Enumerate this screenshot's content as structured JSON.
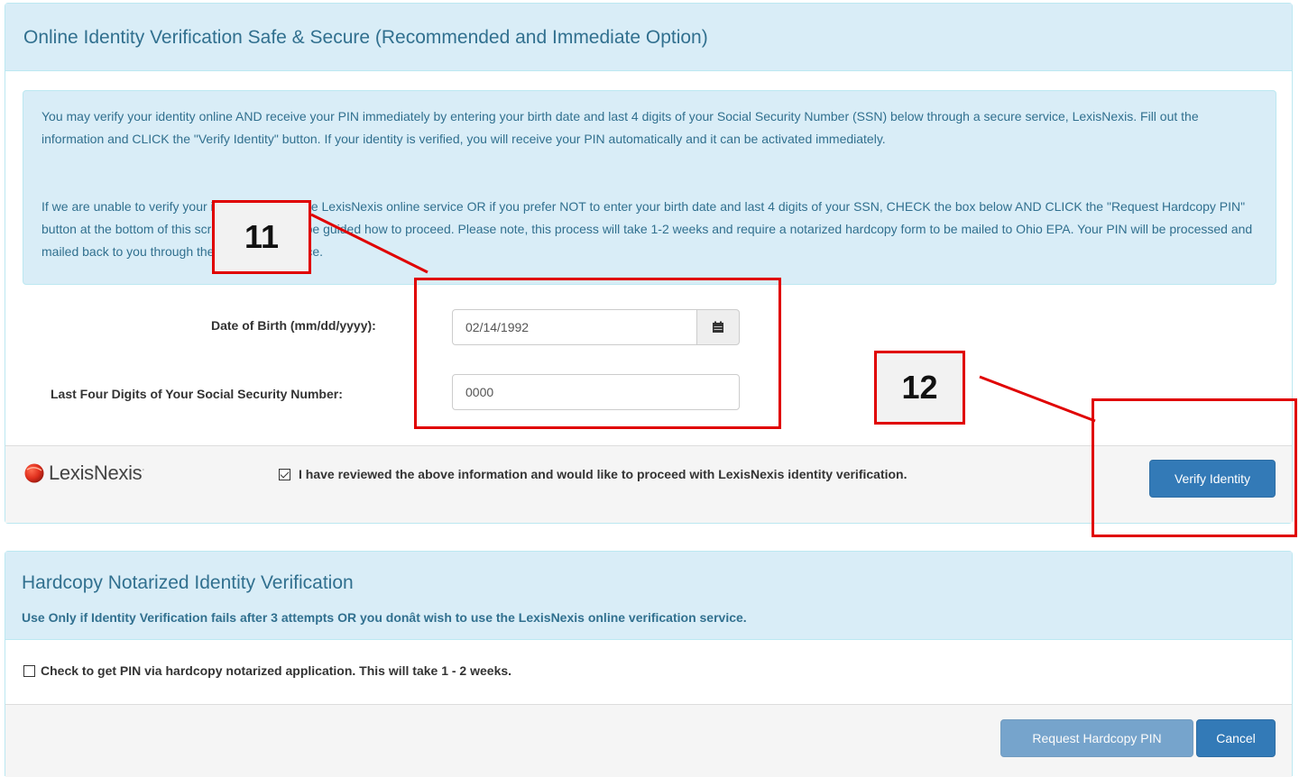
{
  "online_panel": {
    "title": "Online Identity Verification Safe & Secure (Recommended and Immediate Option)",
    "alert_paragraph_1": "You may verify your identity online AND receive your PIN immediately by entering your birth date and last 4 digits of your Social Security Number (SSN) below through a secure service, LexisNexis. Fill out the information and CLICK the \"Verify Identity\" button. If your identity is verified, you will receive your PIN automatically and it can be activated immediately.",
    "alert_paragraph_2": "If we are unable to verify your identity through the LexisNexis online service OR if you prefer NOT to enter your birth date and last 4 digits of your SSN, CHECK the box below AND CLICK the \"Request Hardcopy PIN\" button at the bottom of this screen and you will be guided how to proceed. Please note, this process will take 1-2 weeks and require a notarized hardcopy form to be mailed to Ohio EPA. Your PIN will be processed and mailed back to you through the US Postal Service.",
    "dob_label": "Date of Birth (mm/dd/yyyy):",
    "dob_value": "02/14/1992",
    "ssn_label": "Last Four Digits of Your Social Security Number:",
    "ssn_value": "0000",
    "lexis_logo_text": "LexisNexis",
    "lexis_logo_mark": "·",
    "consent_text": "I have reviewed the above information and would like to proceed with LexisNexis identity verification.",
    "consent_checked": true,
    "verify_button": "Verify Identity"
  },
  "hardcopy_panel": {
    "title": "Hardcopy Notarized Identity Verification",
    "subtitle": "Use Only if Identity Verification fails after 3 attempts OR you donât wish to use the LexisNexis online verification service.",
    "checkbox_text": "Check to get PIN via hardcopy notarized application. This will take 1 - 2 weeks.",
    "checkbox_checked": false,
    "request_button": "Request Hardcopy PIN",
    "cancel_button": "Cancel"
  },
  "annotations": {
    "label_11": "11",
    "label_12": "12",
    "color": "#e00000"
  },
  "colors": {
    "info_bg": "#d9edf7",
    "info_text": "#31708f",
    "primary": "#337ab7"
  },
  "icons": {
    "calendar": "calendar-icon",
    "lexis_logo": "lexisnexis-logo-icon"
  }
}
